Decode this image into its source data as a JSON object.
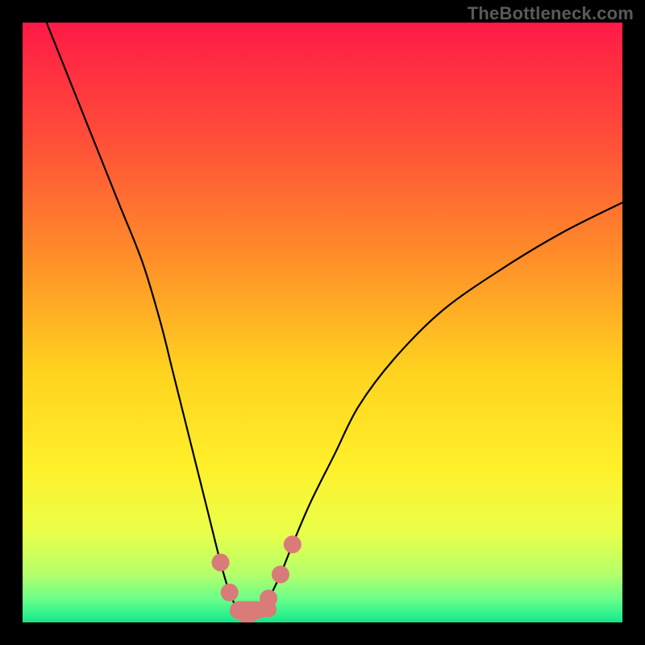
{
  "watermark": "TheBottleneck.com",
  "chart_data": {
    "type": "line",
    "title": "",
    "xlabel": "",
    "ylabel": "",
    "xlim": [
      0,
      100
    ],
    "ylim": [
      0,
      100
    ],
    "series": [
      {
        "name": "bottleneck-curve",
        "x": [
          4,
          8,
          12,
          16,
          20,
          23,
          25,
          27,
          29,
          31,
          33,
          34.5,
          36,
          37.5,
          39,
          41,
          43,
          45,
          48,
          52,
          56,
          62,
          70,
          80,
          90,
          100
        ],
        "y": [
          100,
          90,
          80,
          70,
          60,
          50,
          42,
          34,
          26,
          18,
          10,
          5,
          2,
          1,
          2,
          4,
          8,
          13,
          20,
          28,
          36,
          44,
          52,
          59,
          65,
          70
        ]
      }
    ],
    "markers": {
      "name": "rate-dots",
      "x": [
        33,
        34.5,
        36,
        37.5,
        39,
        41,
        43,
        45
      ],
      "y": [
        10,
        5,
        2,
        1,
        2,
        4,
        8,
        13
      ],
      "color": "#d97b78"
    },
    "background_gradient": {
      "stops": [
        {
          "pct": 0,
          "color": "#ff1a47"
        },
        {
          "pct": 18,
          "color": "#ff4a3a"
        },
        {
          "pct": 38,
          "color": "#ff8a2a"
        },
        {
          "pct": 58,
          "color": "#ffd21f"
        },
        {
          "pct": 74,
          "color": "#fff02a"
        },
        {
          "pct": 85,
          "color": "#eaff4a"
        },
        {
          "pct": 92,
          "color": "#b4ff6a"
        },
        {
          "pct": 96,
          "color": "#6cff8a"
        },
        {
          "pct": 99,
          "color": "#28f08c"
        },
        {
          "pct": 100,
          "color": "#18e088"
        }
      ]
    }
  }
}
